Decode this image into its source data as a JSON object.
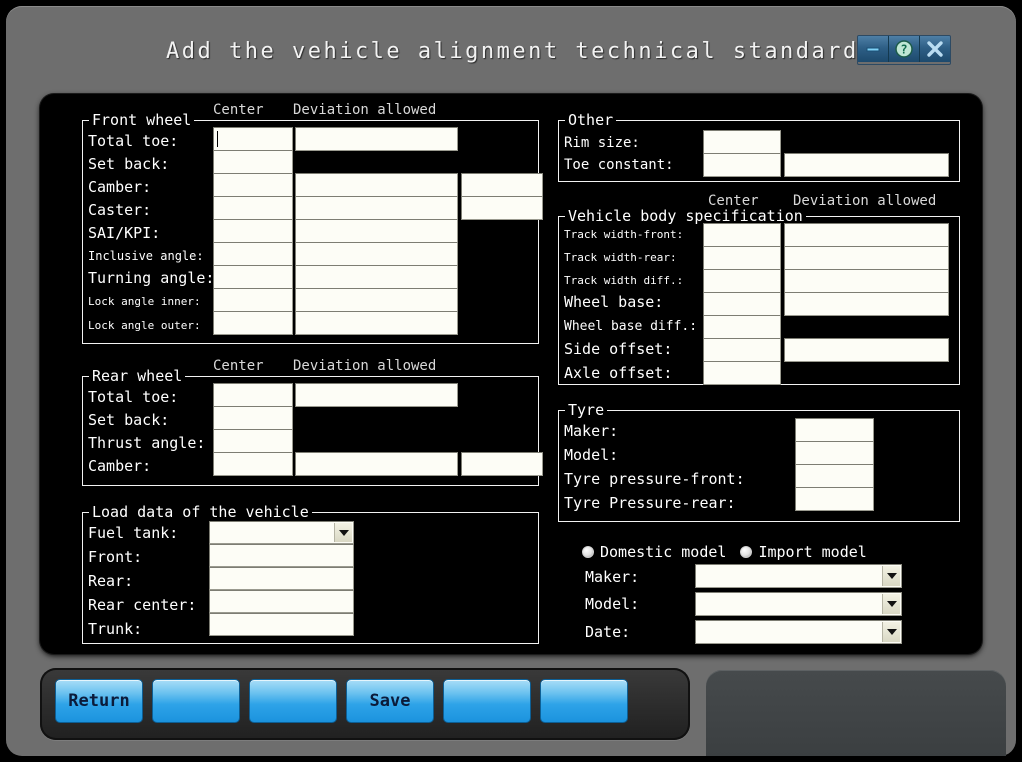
{
  "window": {
    "title": "Add the vehicle alignment technical standard",
    "controls": [
      {
        "name": "minimize-button",
        "icon": "minimize-icon"
      },
      {
        "name": "help-button",
        "icon": "question-mark-icon"
      },
      {
        "name": "close-button",
        "icon": "close-x-icon"
      }
    ]
  },
  "headers": {
    "center": "Center",
    "deviation": "Deviation allowed"
  },
  "front_wheel": {
    "legend": "Front wheel",
    "rows": [
      {
        "label": "Total toe:",
        "center": "",
        "deviation": "",
        "extra": null
      },
      {
        "label": "Set back:",
        "center": "",
        "deviation": null,
        "extra": null
      },
      {
        "label": "Camber:",
        "center": "",
        "deviation": "",
        "extra": ""
      },
      {
        "label": "Caster:",
        "center": "",
        "deviation": "",
        "extra": ""
      },
      {
        "label": "SAI/KPI:",
        "center": "",
        "deviation": "",
        "extra": null
      },
      {
        "label": "Inclusive angle:",
        "center": "",
        "deviation": "",
        "extra": null
      },
      {
        "label": "Turning angle:",
        "center": "",
        "deviation": "",
        "extra": null
      },
      {
        "label": "Lock angle inner:",
        "center": "",
        "deviation": "",
        "extra": null
      },
      {
        "label": "Lock angle outer:",
        "center": "",
        "deviation": "",
        "extra": null
      }
    ]
  },
  "rear_wheel": {
    "legend": "Rear wheel",
    "rows": [
      {
        "label": "Total toe:",
        "center": "",
        "deviation": "",
        "extra": null
      },
      {
        "label": "Set back:",
        "center": "",
        "deviation": null,
        "extra": null
      },
      {
        "label": "Thrust angle:",
        "center": "",
        "deviation": null,
        "extra": null
      },
      {
        "label": "Camber:",
        "center": "",
        "deviation": "",
        "extra": ""
      }
    ]
  },
  "load_data": {
    "legend": "Load data of the vehicle",
    "rows": [
      {
        "label": "Fuel tank:",
        "value": "",
        "type": "combo"
      },
      {
        "label": "Front:",
        "value": "",
        "type": "text"
      },
      {
        "label": "Rear:",
        "value": "",
        "type": "text"
      },
      {
        "label": "Rear center:",
        "value": "",
        "type": "text"
      },
      {
        "label": "Trunk:",
        "value": "",
        "type": "text"
      }
    ]
  },
  "other": {
    "legend": "Other",
    "rows": [
      {
        "label": "Rim size:",
        "center": "",
        "deviation": null
      },
      {
        "label": "Toe constant:",
        "center": "",
        "deviation": ""
      }
    ]
  },
  "vehicle_body": {
    "legend": "Vehicle body specification",
    "rows": [
      {
        "label": "Track width-front:",
        "center": "",
        "deviation": ""
      },
      {
        "label": "Track width-rear:",
        "center": "",
        "deviation": ""
      },
      {
        "label": "Track width diff.:",
        "center": "",
        "deviation": ""
      },
      {
        "label": "Wheel base:",
        "center": "",
        "deviation": ""
      },
      {
        "label": "Wheel base diff.:",
        "center": "",
        "deviation": null
      },
      {
        "label": "Side offset:",
        "center": "",
        "deviation": ""
      },
      {
        "label": "Axle offset:",
        "center": "",
        "deviation": null
      }
    ]
  },
  "tyre": {
    "legend": "Tyre",
    "rows": [
      {
        "label": "Maker:",
        "value": ""
      },
      {
        "label": "Model:",
        "value": ""
      },
      {
        "label": "Tyre pressure-front:",
        "value": ""
      },
      {
        "label": "Tyre Pressure-rear:",
        "value": ""
      }
    ]
  },
  "model_source": {
    "options": [
      {
        "label": "Domestic model",
        "selected": false
      },
      {
        "label": "Import model",
        "selected": false
      }
    ],
    "fields": [
      {
        "label": "Maker:",
        "value": ""
      },
      {
        "label": "Model:",
        "value": ""
      },
      {
        "label": "Date:",
        "value": ""
      }
    ]
  },
  "toolbar": {
    "buttons": [
      {
        "label": "Return"
      },
      {
        "label": ""
      },
      {
        "label": ""
      },
      {
        "label": "Save"
      },
      {
        "label": ""
      },
      {
        "label": ""
      }
    ]
  },
  "colors": {
    "window_frame": "#6e6e6e",
    "content_bg": "#000000",
    "field_bg": "#fdfdf6",
    "button_blue": "#2ea3e8",
    "title_text": "#f2f2f2"
  }
}
